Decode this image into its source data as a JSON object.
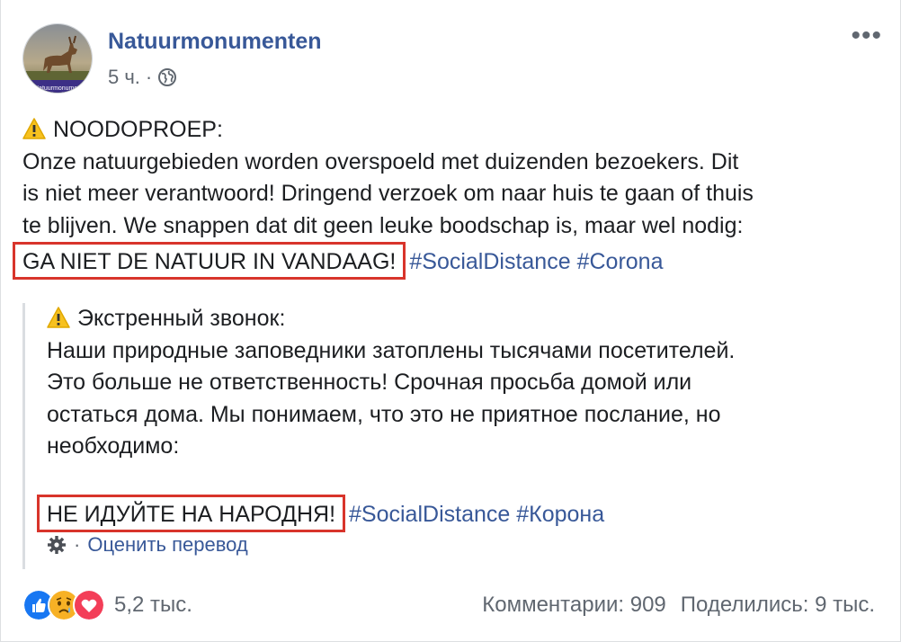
{
  "post": {
    "page_name": "Natuurmonumenten",
    "avatar_text": "Natuurmonumenten",
    "timestamp": "5 ч.",
    "separator": "·",
    "more_label": "•••",
    "original": {
      "heading": "NOODOPROEP:",
      "body_lines": [
        "Onze natuurgebieden worden overspoeld met duizenden bezoekers. Dit",
        "is niet meer verantwoord! Dringend verzoek om naar huis te gaan of thuis",
        "te blijven. We snappen dat dit geen leuke boodschap is, maar wel nodig:"
      ],
      "highlight": "GA NIET DE NATUUR IN VANDAAG!",
      "hashtags": [
        "#SocialDistance",
        "#Corona"
      ]
    },
    "translation": {
      "heading": "Экстренный звонок:",
      "body_lines": [
        "Наши природные заповедники затоплены тысячами посетителей.",
        "Это больше не ответственность! Срочная просьба домой или",
        "остаться дома. Мы понимаем, что это не приятное послание, но",
        "необходимо:"
      ],
      "highlight": "НЕ ИДУЙТЕ НА НАРОДНЯ!",
      "hashtags": [
        "#SocialDistance",
        "#Корона"
      ],
      "rate_label": "Оценить перевод"
    },
    "footer": {
      "reactions": [
        "like-icon",
        "sad-icon",
        "love-icon"
      ],
      "reaction_count": "5,2 тыс.",
      "comments": "Комментарии: 909",
      "shares": "Поделились: 9 тыс."
    },
    "colors": {
      "link": "#385898",
      "highlight_border": "#d8342b",
      "like": "#1877f2",
      "love": "#f33e58",
      "sad": "#f7b125"
    }
  }
}
